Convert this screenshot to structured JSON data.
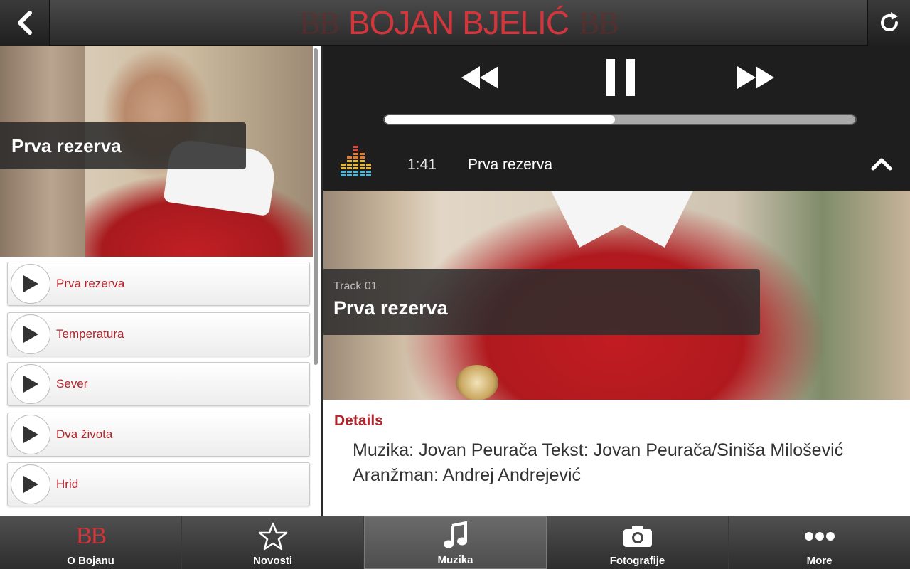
{
  "header": {
    "logo_mark": "BB",
    "title": "BOJAN BJELIĆ",
    "back_icon": "chevron-left-icon",
    "refresh_icon": "refresh-icon"
  },
  "left": {
    "cover_title": "Prva rezerva",
    "tracks": [
      {
        "title": "Prva rezerva"
      },
      {
        "title": "Temperatura"
      },
      {
        "title": "Sever"
      },
      {
        "title": "Dva života"
      },
      {
        "title": "Hrid"
      }
    ]
  },
  "player": {
    "progress_fraction": 0.49,
    "time": "1:41",
    "now_playing": "Prva rezerva"
  },
  "art": {
    "track_label": "Track 01",
    "title": "Prva rezerva"
  },
  "details": {
    "heading": "Details",
    "text": "Muzika: Jovan Peurača Tekst: Jovan Peurača/Siniša Milošević Aranžman: Andrej Andrejević"
  },
  "tabs": [
    {
      "label": "O Bojanu",
      "icon": "bb-logo-icon",
      "mark": "BB"
    },
    {
      "label": "Novosti",
      "icon": "star-icon"
    },
    {
      "label": "Muzika",
      "icon": "music-note-icon",
      "active": true
    },
    {
      "label": "Fotografije",
      "icon": "camera-icon"
    },
    {
      "label": "More",
      "icon": "more-dots-icon"
    }
  ],
  "colors": {
    "accent": "#d2363c",
    "track_text": "#b4232a",
    "header_bg": "#3a3a3a",
    "player_bg": "#1e1e1e"
  }
}
